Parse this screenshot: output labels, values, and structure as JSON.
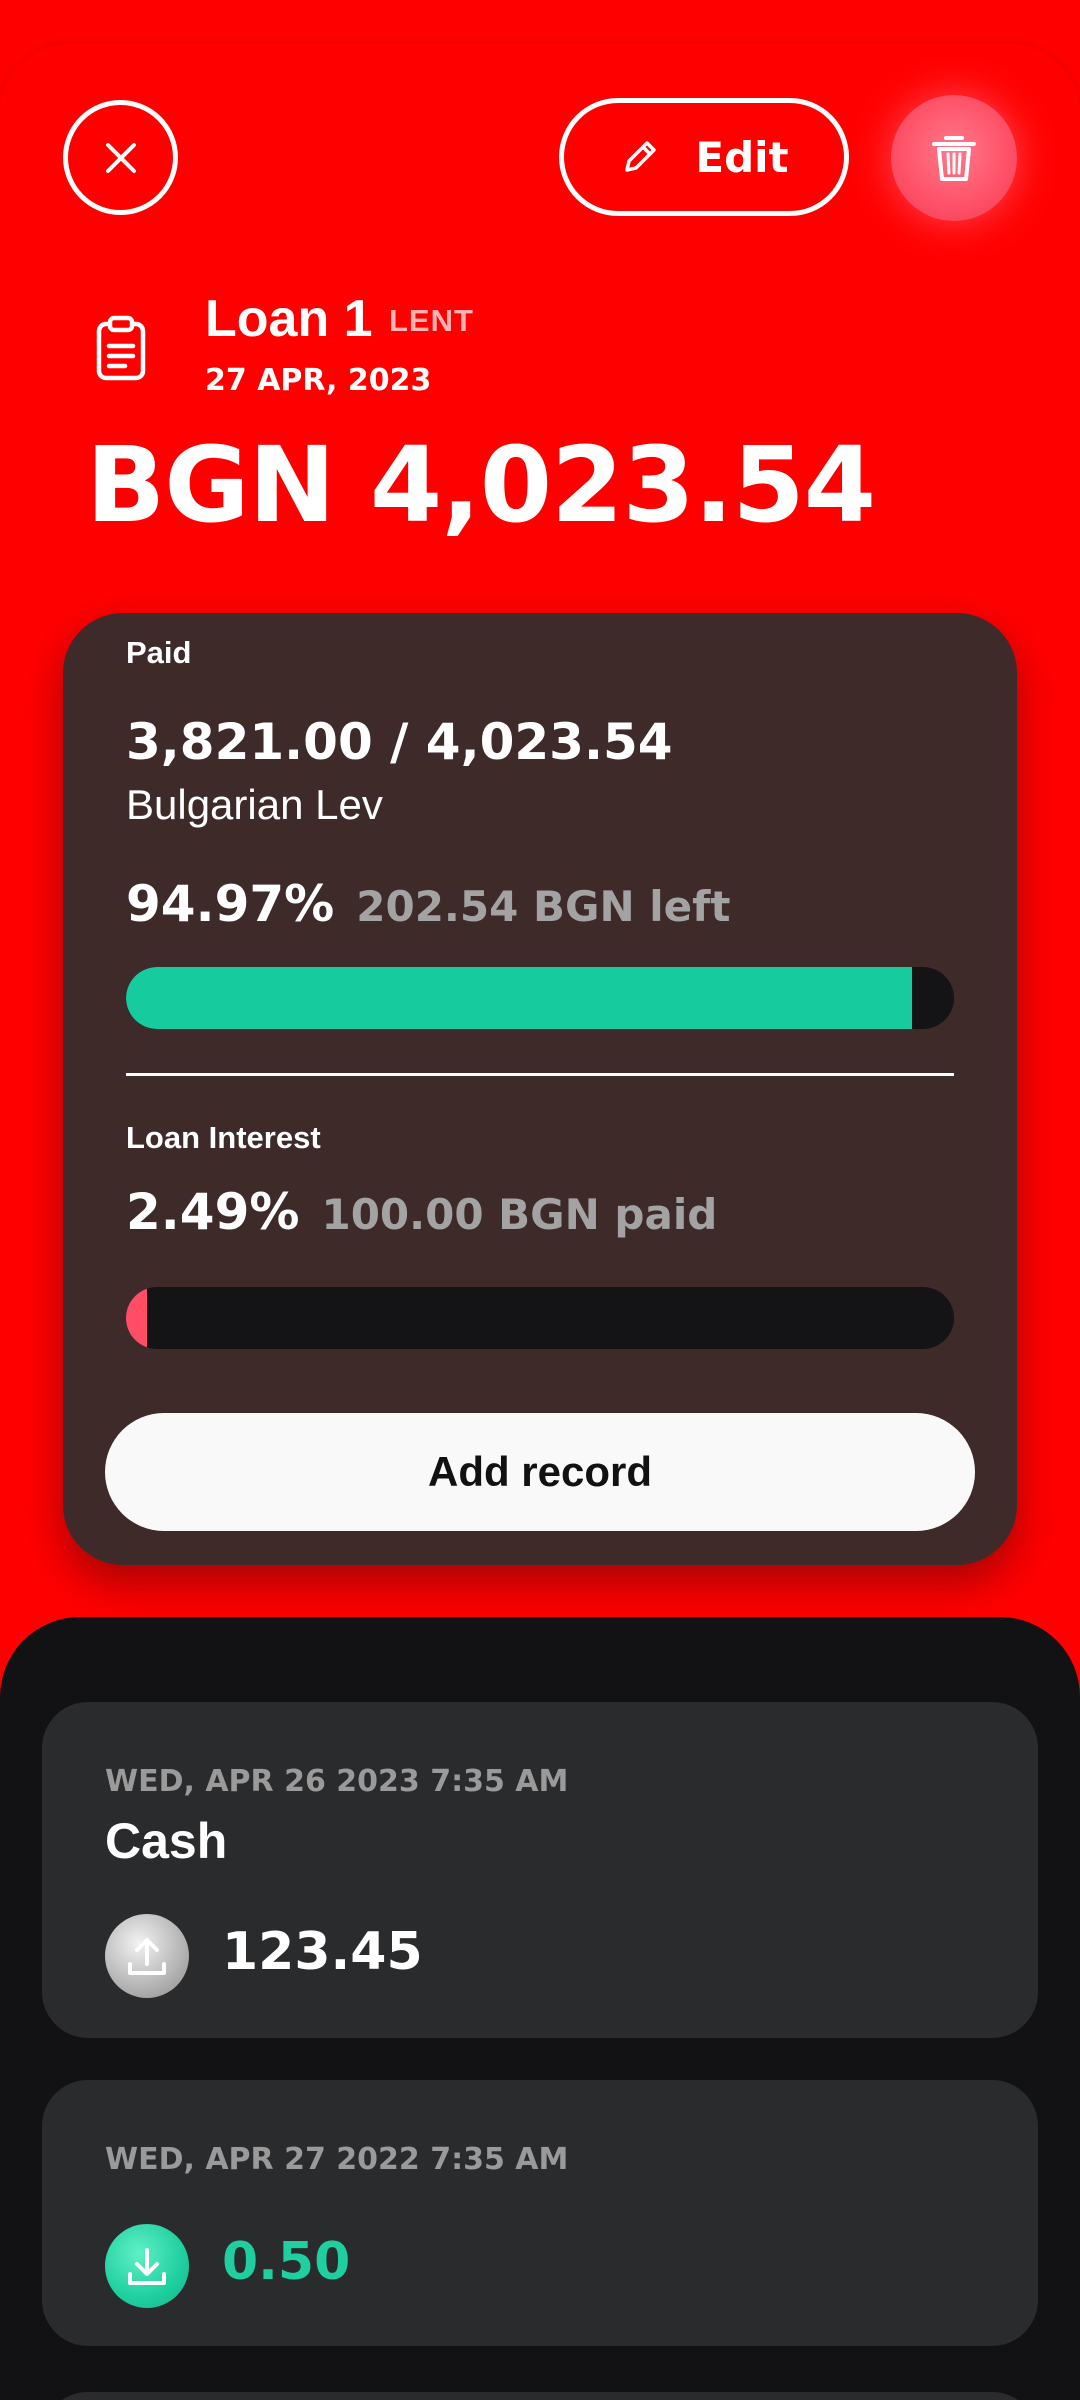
{
  "colors": {
    "background": "#ff0000",
    "card": "#3f2a2a",
    "progress_fill": "#16cc9f",
    "interest_fill": "#ff4d66",
    "records_bg": "#121214",
    "record_card": "#2a2b2d",
    "income_amount": "#1fcf9f"
  },
  "header": {
    "close_icon": "close-icon",
    "edit_label": "Edit",
    "edit_icon": "pencil-icon",
    "delete_icon": "trash-icon"
  },
  "loan": {
    "icon": "clipboard-icon",
    "name": "Loan 1",
    "type": "LENT",
    "date": "27 APR, 2023",
    "amount": "BGN 4,023.54"
  },
  "summary": {
    "paid_label": "Paid",
    "paid_ratio": "3,821.00 / 4,023.54",
    "currency_name": "Bulgarian Lev",
    "paid_percent": "94.97%",
    "left_text": "202.54 BGN left",
    "paid_progress": 0.9497,
    "interest_label": "Loan Interest",
    "interest_percent": "2.49%",
    "interest_paid_text": "100.00 BGN paid",
    "interest_progress": 0.0249,
    "add_record_label": "Add record"
  },
  "records": [
    {
      "date": "WED, APR 26 2023 7:35 AM",
      "title": "Cash",
      "icon": "upload-icon",
      "amount": "123.45"
    },
    {
      "date": "WED, APR 27 2022 7:35 AM",
      "title": "",
      "icon": "download-icon",
      "amount": "0.50"
    }
  ]
}
